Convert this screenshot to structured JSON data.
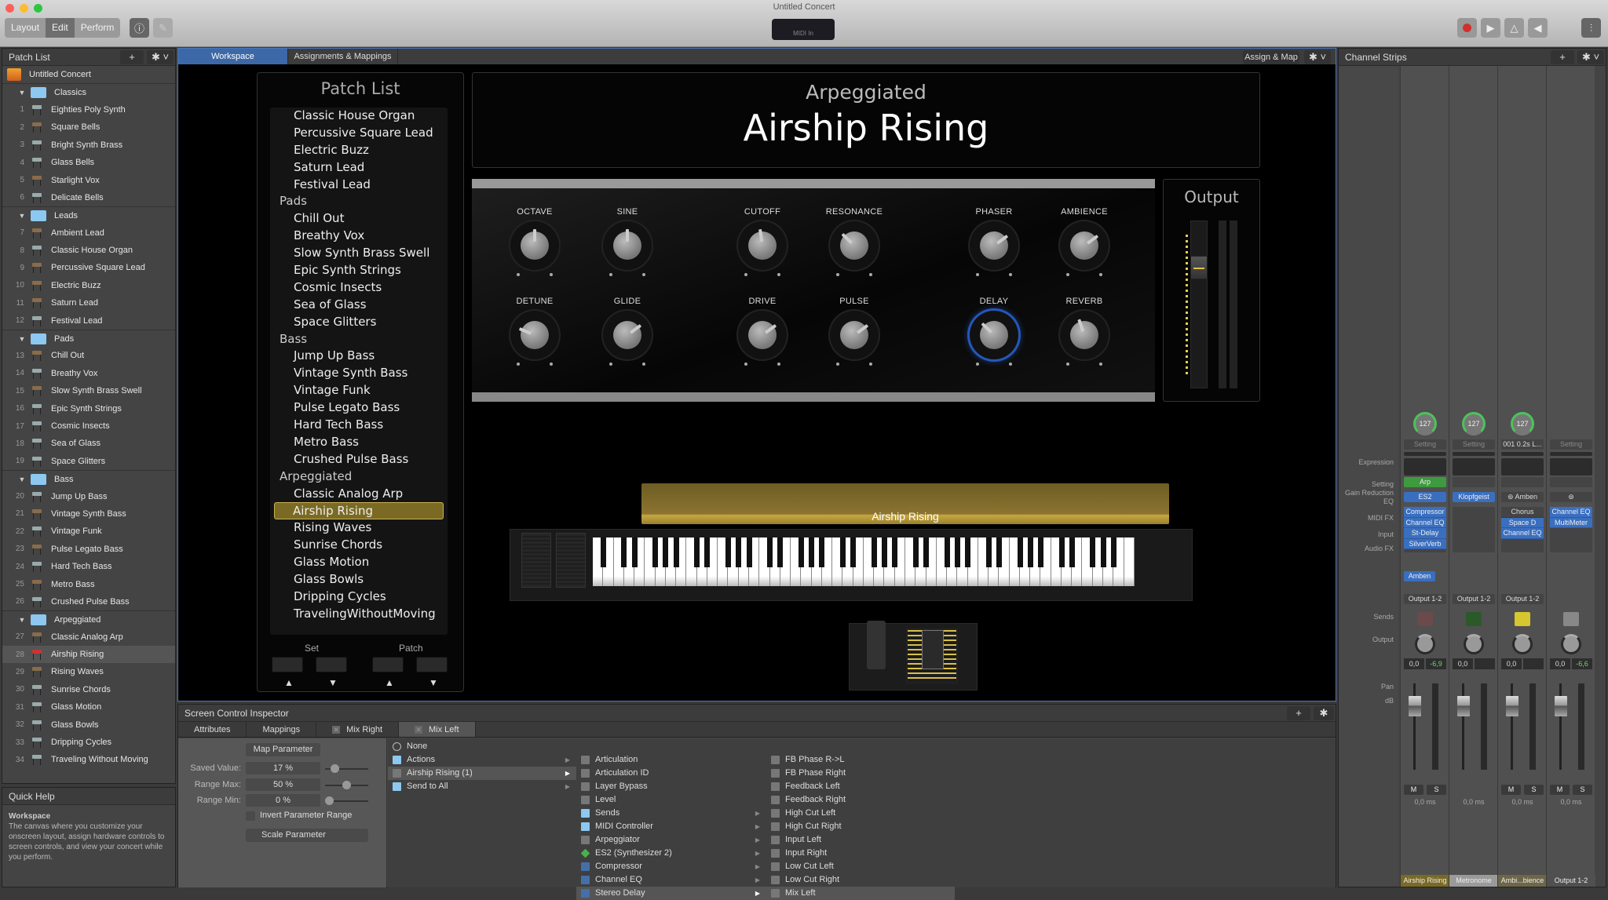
{
  "window": {
    "title": "Untitled Concert",
    "midi_label": "MIDI In"
  },
  "toolbar": {
    "modes": [
      "Layout",
      "Edit",
      "Perform"
    ],
    "active_mode": "Edit",
    "info_icon": "info-icon",
    "pencil_icon": "pencil-icon",
    "transport": [
      "record-icon",
      "play-icon",
      "metronome-icon",
      "speaker-icon"
    ],
    "mixer_icon": "mixer-icon",
    "record_color": "#d0312d"
  },
  "patch_list": {
    "title": "Patch List",
    "concert": "Untitled Concert",
    "sets": [
      {
        "name": "Classics",
        "patches": [
          {
            "n": "1",
            "name": "Eighties Poly Synth",
            "kb": "silver"
          },
          {
            "n": "2",
            "name": "Square Bells",
            "kb": "brown"
          },
          {
            "n": "3",
            "name": "Bright Synth Brass",
            "kb": "silver"
          },
          {
            "n": "4",
            "name": "Glass Bells",
            "kb": "silver"
          },
          {
            "n": "5",
            "name": "Starlight Vox",
            "kb": "brown"
          },
          {
            "n": "6",
            "name": "Delicate Bells",
            "kb": "silver"
          }
        ]
      },
      {
        "name": "Leads",
        "patches": [
          {
            "n": "7",
            "name": "Ambient Lead",
            "kb": "brown"
          },
          {
            "n": "8",
            "name": "Classic House Organ",
            "kb": "silver"
          },
          {
            "n": "9",
            "name": "Percussive Square Lead",
            "kb": "brown"
          },
          {
            "n": "10",
            "name": "Electric Buzz",
            "kb": "brown"
          },
          {
            "n": "11",
            "name": "Saturn Lead",
            "kb": "brown"
          },
          {
            "n": "12",
            "name": "Festival Lead",
            "kb": "silver"
          }
        ]
      },
      {
        "name": "Pads",
        "patches": [
          {
            "n": "13",
            "name": "Chill Out",
            "kb": "brown"
          },
          {
            "n": "14",
            "name": "Breathy Vox",
            "kb": "silver"
          },
          {
            "n": "15",
            "name": "Slow Synth Brass Swell",
            "kb": "brown"
          },
          {
            "n": "16",
            "name": "Epic Synth Strings",
            "kb": "silver"
          },
          {
            "n": "17",
            "name": "Cosmic Insects",
            "kb": "silver"
          },
          {
            "n": "18",
            "name": "Sea of Glass",
            "kb": "silver"
          },
          {
            "n": "19",
            "name": "Space Glitters",
            "kb": "silver"
          }
        ]
      },
      {
        "name": "Bass",
        "patches": [
          {
            "n": "20",
            "name": "Jump Up Bass",
            "kb": "silver"
          },
          {
            "n": "21",
            "name": "Vintage Synth Bass",
            "kb": "brown"
          },
          {
            "n": "22",
            "name": "Vintage Funk",
            "kb": "silver"
          },
          {
            "n": "23",
            "name": "Pulse Legato Bass",
            "kb": "brown"
          },
          {
            "n": "24",
            "name": "Hard Tech Bass",
            "kb": "silver"
          },
          {
            "n": "25",
            "name": "Metro Bass",
            "kb": "brown"
          },
          {
            "n": "26",
            "name": "Crushed Pulse Bass",
            "kb": "silver"
          }
        ]
      },
      {
        "name": "Arpeggiated",
        "patches": [
          {
            "n": "27",
            "name": "Classic Analog Arp",
            "kb": "brown"
          },
          {
            "n": "28",
            "name": "Airship Rising",
            "kb": "red",
            "selected": true
          },
          {
            "n": "29",
            "name": "Rising Waves",
            "kb": "brown"
          },
          {
            "n": "30",
            "name": "Sunrise Chords",
            "kb": "silver"
          },
          {
            "n": "31",
            "name": "Glass Motion",
            "kb": "silver"
          },
          {
            "n": "32",
            "name": "Glass Bowls",
            "kb": "silver"
          },
          {
            "n": "33",
            "name": "Dripping Cycles",
            "kb": "silver"
          },
          {
            "n": "34",
            "name": "Traveling Without Moving",
            "kb": "silver"
          }
        ]
      }
    ]
  },
  "quick_help": {
    "title": "Quick Help",
    "heading": "Workspace",
    "body": "The canvas where you customize your onscreen layout, assign hardware controls to screen controls, and view your concert while you perform."
  },
  "workspace": {
    "tabs": [
      "Workspace",
      "Assignments & Mappings"
    ],
    "assign_map": "Assign & Map",
    "patch_widget": {
      "title": "Patch List",
      "items": [
        {
          "t": "Classic House Organ"
        },
        {
          "t": "Percussive Square Lead"
        },
        {
          "t": "Electric Buzz"
        },
        {
          "t": "Saturn Lead"
        },
        {
          "t": "Festival Lead"
        },
        {
          "t": "Pads",
          "cat": true
        },
        {
          "t": "Chill Out"
        },
        {
          "t": "Breathy Vox"
        },
        {
          "t": "Slow Synth Brass Swell"
        },
        {
          "t": "Epic Synth Strings"
        },
        {
          "t": "Cosmic Insects"
        },
        {
          "t": "Sea of Glass"
        },
        {
          "t": "Space Glitters"
        },
        {
          "t": "Bass",
          "cat": true
        },
        {
          "t": "Jump Up Bass"
        },
        {
          "t": "Vintage Synth Bass"
        },
        {
          "t": "Vintage Funk"
        },
        {
          "t": "Pulse Legato Bass"
        },
        {
          "t": "Hard Tech Bass"
        },
        {
          "t": "Metro Bass"
        },
        {
          "t": "Crushed Pulse Bass"
        },
        {
          "t": "Arpeggiated",
          "cat": true
        },
        {
          "t": "Classic Analog Arp"
        },
        {
          "t": "Airship Rising",
          "sel": true
        },
        {
          "t": "Rising Waves"
        },
        {
          "t": "Sunrise Chords"
        },
        {
          "t": "Glass Motion"
        },
        {
          "t": "Glass Bowls"
        },
        {
          "t": "Dripping Cycles"
        },
        {
          "t": "TravelingWithoutMoving"
        }
      ],
      "set_label": "Set",
      "patch_label": "Patch"
    },
    "set_name": "Arpeggiated",
    "patch_name": "Airship Rising",
    "knobs": [
      {
        "label": "OCTAVE",
        "value": 0.5
      },
      {
        "label": "SINE",
        "value": 0.5
      },
      {
        "label": "CUTOFF",
        "value": 0.47
      },
      {
        "label": "RESONANCE",
        "value": 0.33
      },
      {
        "label": "PHASER",
        "value": 0.7
      },
      {
        "label": "AMBIENCE",
        "value": 0.7
      },
      {
        "label": "DETUNE",
        "value": 0.25
      },
      {
        "label": "GLIDE",
        "value": 0.7
      },
      {
        "label": "DRIVE",
        "value": 0.7
      },
      {
        "label": "PULSE",
        "value": 0.7
      },
      {
        "label": "DELAY",
        "value": 0.33,
        "active": true
      },
      {
        "label": "REVERB",
        "value": 0.43
      }
    ],
    "output": {
      "title": "Output",
      "level": 0.72
    },
    "keyboard_label": "Airship Rising"
  },
  "channel_strips": {
    "title": "Channel Strips",
    "row_labels": [
      "Expression",
      "Setting",
      "Gain Reduction",
      "EQ",
      "MIDI FX",
      "Input",
      "Audio FX",
      "Sends",
      "Output",
      "Pan",
      "dB"
    ],
    "strips": [
      {
        "name": "Airship Rising",
        "expression": "127",
        "setting": "Setting",
        "midi_fx": "Arp",
        "input": "ES2",
        "audio_fx": [
          "Compressor",
          "Channel EQ",
          "St-Delay",
          "SilverVerb"
        ],
        "send": "Amben",
        "output": "Output 1-2",
        "db": "0,0",
        "peak": "-6,9",
        "delay": "0,0 ms",
        "name_bg": "#7a6a26"
      },
      {
        "name": "Metronome",
        "expression": "127",
        "setting": "Setting",
        "midi_fx": "",
        "input": "Klopfgeist",
        "audio_fx": [],
        "send": "",
        "output": "Output 1-2",
        "db": "0,0",
        "peak": "",
        "delay": "0,0 ms",
        "name_bg": "#9a9a9a"
      },
      {
        "name": "Ambi...bience",
        "expression": "127",
        "setting": "001 0.2s L...",
        "midi_fx": "",
        "input": "Amben",
        "audio_fx": [
          "Chorus",
          "Space D",
          "Channel EQ"
        ],
        "send": "",
        "output": "Output 1-2",
        "db": "0,0",
        "peak": "",
        "delay": "0,0 ms",
        "name_bg": "#6e6648"
      },
      {
        "name": "Output 1-2",
        "expression": "",
        "setting": "Setting",
        "midi_fx": "",
        "input": "",
        "audio_fx": [
          "Channel EQ",
          "MultiMeter"
        ],
        "send": "",
        "output": "",
        "db": "0,0",
        "peak": "-6,6",
        "delay": "0,0 ms",
        "name_bg": "#505050"
      }
    ],
    "mute": "M",
    "solo": "S"
  },
  "inspector": {
    "title": "Screen Control Inspector",
    "tabs": [
      "Attributes",
      "Mappings",
      "Mix Right",
      "Mix Left"
    ],
    "active_tab": "Mix Left",
    "map_parameter": "Map Parameter",
    "saved_value": {
      "label": "Saved Value:",
      "value": "17 %",
      "fraction": 0.17
    },
    "range_max": {
      "label": "Range Max:",
      "value": "50 %",
      "fraction": 0.5
    },
    "range_min": {
      "label": "Range Min:",
      "value": "0 %",
      "fraction": 0
    },
    "invert": "Invert Parameter Range",
    "scale": "Scale Parameter",
    "col1": [
      {
        "t": "None",
        "ico": "none"
      },
      {
        "t": "Actions",
        "ico": "fold",
        "sub": true
      },
      {
        "t": "Airship Rising (1)",
        "ico": "",
        "sub": true,
        "hl": true
      },
      {
        "t": "Send to All",
        "ico": "fold",
        "sub": true
      }
    ],
    "col2": [
      {
        "t": "Articulation",
        "ico": ""
      },
      {
        "t": "Articulation ID",
        "ico": ""
      },
      {
        "t": "Layer Bypass",
        "ico": ""
      },
      {
        "t": "Level",
        "ico": ""
      },
      {
        "t": "Sends",
        "ico": "fold",
        "sub": true
      },
      {
        "t": "MIDI Controller",
        "ico": "fold",
        "sub": true
      },
      {
        "t": "Arpeggiator",
        "ico": "",
        "sub": true
      },
      {
        "t": "ES2  (Synthesizer 2)",
        "ico": "green",
        "sub": true
      },
      {
        "t": "Compressor",
        "ico": "plug",
        "sub": true
      },
      {
        "t": "Channel EQ",
        "ico": "plug",
        "sub": true
      },
      {
        "t": "Stereo Delay",
        "ico": "plug",
        "sub": true,
        "hl": true
      }
    ],
    "col3": [
      {
        "t": "FB Phase R->L"
      },
      {
        "t": "FB Phase Right"
      },
      {
        "t": "Feedback Left"
      },
      {
        "t": "Feedback Right"
      },
      {
        "t": "High Cut Left"
      },
      {
        "t": "High Cut Right"
      },
      {
        "t": "Input Left"
      },
      {
        "t": "Input Right"
      },
      {
        "t": "Low Cut Left"
      },
      {
        "t": "Low Cut Right"
      },
      {
        "t": "Mix Left",
        "hl": true
      }
    ]
  }
}
